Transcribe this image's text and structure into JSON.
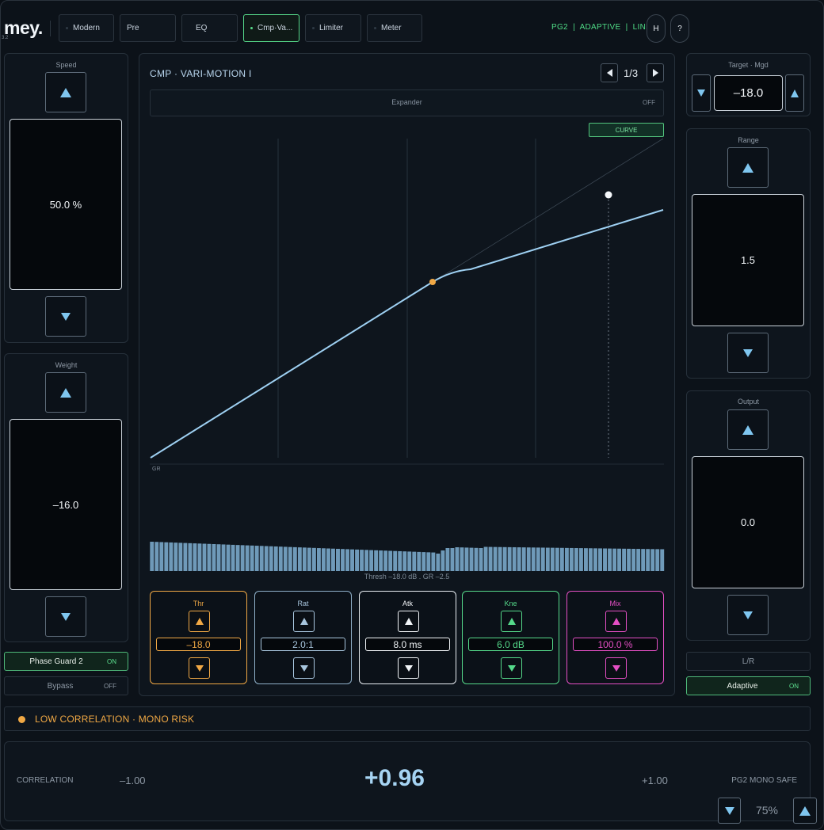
{
  "app": {
    "logo": "mey.",
    "version": "3.2"
  },
  "tabs": [
    {
      "label": "Modern",
      "active": false
    },
    {
      "label": "Pre",
      "active": false
    },
    {
      "label": "EQ",
      "active": false
    },
    {
      "label": "Cmp·Va...",
      "active": true
    },
    {
      "label": "Limiter",
      "active": false
    },
    {
      "label": "Meter",
      "active": false
    }
  ],
  "status": {
    "text": "PG2  |  ADAPTIVE  |  LINK"
  },
  "top_buttons": {
    "help_h": "H",
    "help_q": "?"
  },
  "left": {
    "speed": {
      "label": "Speed",
      "value": "50.0 %"
    },
    "weight": {
      "label": "Weight",
      "value": "–16.0"
    },
    "phase_guard": {
      "label": "Phase Guard 2",
      "state": "ON"
    },
    "bypass": {
      "label": "Bypass",
      "state": "OFF"
    }
  },
  "right": {
    "target": {
      "label": "Target · Mgd",
      "value": "–18.0"
    },
    "range": {
      "label": "Range",
      "value": "1.5"
    },
    "output": {
      "label": "Output",
      "value": "0.0"
    },
    "lr": {
      "label": "L/R"
    },
    "adaptive": {
      "label": "Adaptive",
      "state": "ON"
    }
  },
  "compressor": {
    "title": "CMP · VARI-MOTION I",
    "page": "1/3",
    "expander": {
      "label": "Expander",
      "state": "OFF"
    },
    "curve_button": "CURVE",
    "gr_label": "GR",
    "thresh_text": "Thresh –18.0 dB . GR –2.5",
    "params": [
      {
        "name": "Thr",
        "value": "–18.0",
        "color": "#f0a845"
      },
      {
        "name": "Rat",
        "value": "2.0:1",
        "color": "#a8c6de"
      },
      {
        "name": "Atk",
        "value": "8.0 ms",
        "color": "#f1f4f7"
      },
      {
        "name": "Kne",
        "value": "6.0 dB",
        "color": "#55d98a"
      },
      {
        "name": "Mix",
        "value": "100.0 %",
        "color": "#e44fc4"
      }
    ]
  },
  "warning": {
    "text": "LOW CORRELATION · MONO RISK",
    "color": "#f0a844"
  },
  "meter": {
    "label": "CORRELATION",
    "min": "–1.00",
    "value": "+0.96",
    "max": "+1.00",
    "status": "PG2 MONO SAFE",
    "zoom": "75%"
  },
  "colors": {
    "accent_green": "#56d98a",
    "curve": "#9ed0f2",
    "bars": "#6f9ab9"
  }
}
